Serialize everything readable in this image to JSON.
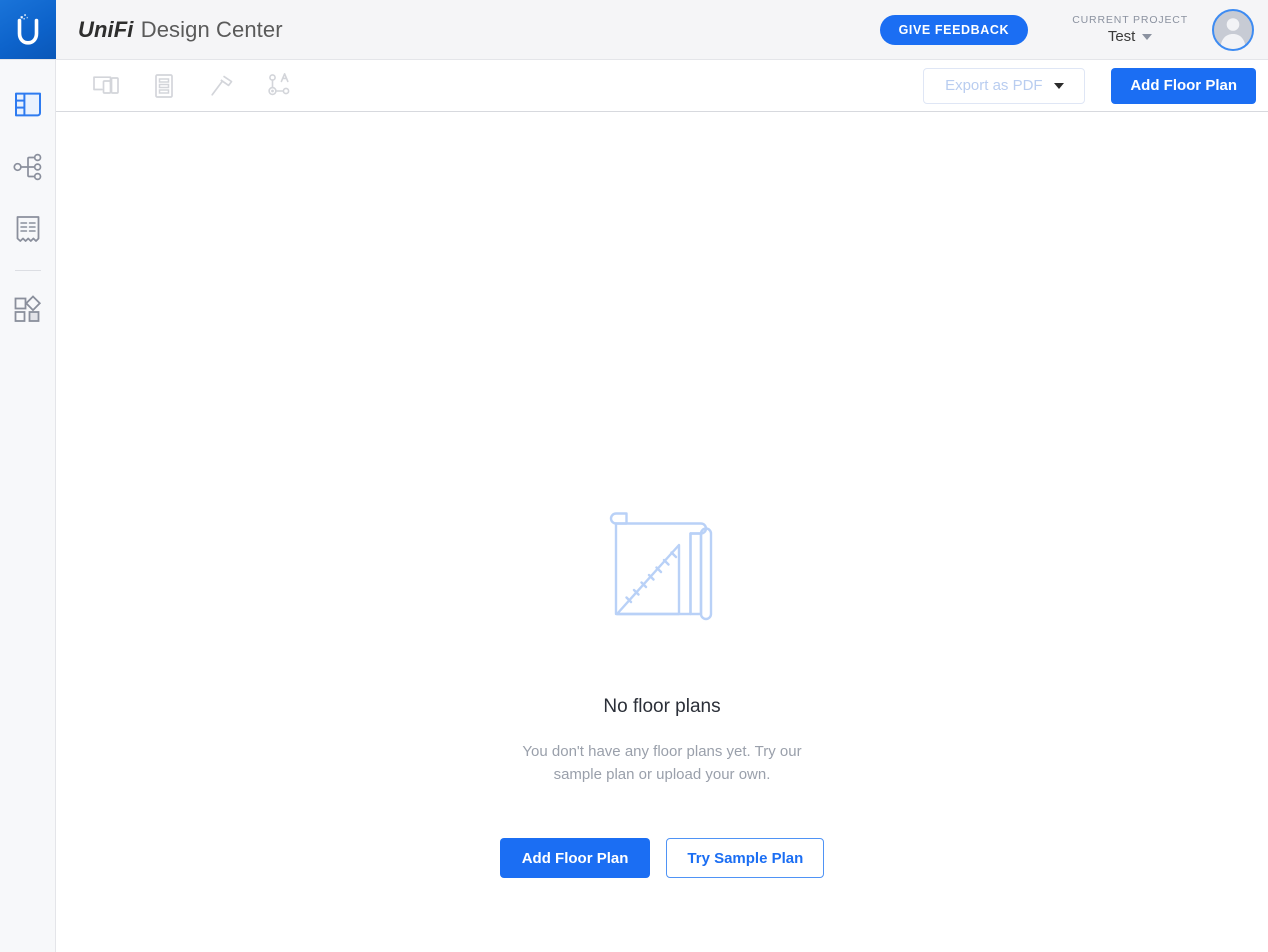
{
  "header": {
    "logo_icon": "ubiquiti-u-logo-icon",
    "brand_primary": "UniFi",
    "brand_secondary": " Design Center",
    "feedback_label": "GIVE FEEDBACK",
    "project_label": "CURRENT PROJECT",
    "project_value": "Test",
    "caret_icon": "chevron-down-icon",
    "avatar_icon": "user-avatar-icon",
    "accent_color": "#1b6ef3",
    "background_color": "#f5f5f7"
  },
  "sidebar": {
    "items": [
      {
        "name": "floor-plans",
        "icon": "floor-plan-icon",
        "active": true
      },
      {
        "name": "topology",
        "icon": "network-topology-icon",
        "active": false
      },
      {
        "name": "bill-of-materials",
        "icon": "receipt-icon",
        "active": false
      },
      {
        "name": "shapes",
        "icon": "shapes-grid-icon",
        "active": false
      }
    ],
    "active_color": "#2e7bf0",
    "inactive_color": "#8a8f9c"
  },
  "toolbar": {
    "tools": [
      {
        "name": "devices-tool",
        "icon": "devices-icon"
      },
      {
        "name": "notes-tool",
        "icon": "document-list-icon"
      },
      {
        "name": "build-tool",
        "icon": "hammer-icon"
      },
      {
        "name": "annotate-tool",
        "icon": "node-annotation-icon"
      }
    ],
    "export_label": "Export as PDF",
    "export_disabled": true,
    "export_caret_icon": "chevron-down-icon",
    "add_floor_plan_label": "Add Floor Plan"
  },
  "empty_state": {
    "illustration_icon": "blueprint-ruler-icon",
    "title": "No floor plans",
    "subtitle": "You don't have any floor plans yet. Try our sample plan or upload your own.",
    "primary_action": "Add Floor Plan",
    "secondary_action": "Try Sample Plan"
  }
}
